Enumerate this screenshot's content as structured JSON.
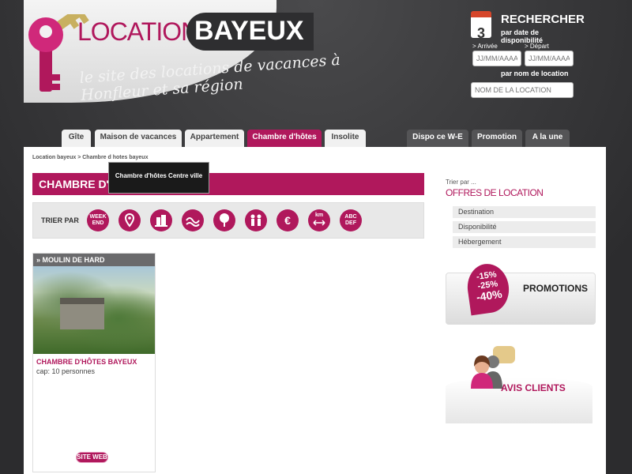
{
  "header": {
    "logo_location": "LOCATION",
    "logo_bayeux": "BAYEUX",
    "tagline": "le site des locations de vacances à Honfleur et sa région"
  },
  "search": {
    "calendar_day": "3",
    "title": "RECHERCHER",
    "subtitle": "par date de disponibilité",
    "arrival_label": "> Arrivée",
    "departure_label": "> Départ",
    "arrival_placeholder": "JJ/MM/AAAA",
    "departure_placeholder": "JJ/MM/AAAA",
    "name_label": "par nom de location",
    "name_placeholder": "NOM DE LA LOCATION"
  },
  "nav": {
    "tabs": [
      {
        "label": "Gîte"
      },
      {
        "label": "Maison de vacances"
      },
      {
        "label": "Appartement"
      },
      {
        "label": "Chambre d'hôtes"
      },
      {
        "label": "Insolite"
      },
      {
        "label": "Dispo ce W-E"
      },
      {
        "label": "Promotion"
      },
      {
        "label": "A la une"
      }
    ]
  },
  "breadcrumb": {
    "home": "Location bayeux",
    "sep": ">",
    "current": "Chambre d hotes bayeux"
  },
  "main": {
    "title": "CHAMBRE D'HÔTES BAYEUX",
    "tooltip": "Chambre d'hôtes Centre ville",
    "sort_label": "TRIER PAR",
    "sort_icons": {
      "weekend": "WEEK END",
      "km": "km",
      "euro": "€",
      "alpha": "ABC DEF"
    }
  },
  "listing": {
    "header": "» MOULIN DE HARD",
    "title": "CHAMBRE D'HÔTES BAYEUX",
    "capacity": "cap: 10 personnes",
    "site_button": "SITE WEB"
  },
  "sidebar": {
    "kicker": "Trier par ...",
    "title": "OFFRES DE LOCATION",
    "filters": [
      "Destination",
      "Disponibilité",
      "Hébergement"
    ],
    "promo": {
      "badge": [
        "-15%",
        "-25%",
        "-40%"
      ],
      "label": "PROMOTIONS"
    },
    "avis_label": "AVIS CLIENTS"
  },
  "colors": {
    "brand": "#b0185c",
    "header_bg": "#3a3a3c",
    "tab_dark": "#545456"
  }
}
